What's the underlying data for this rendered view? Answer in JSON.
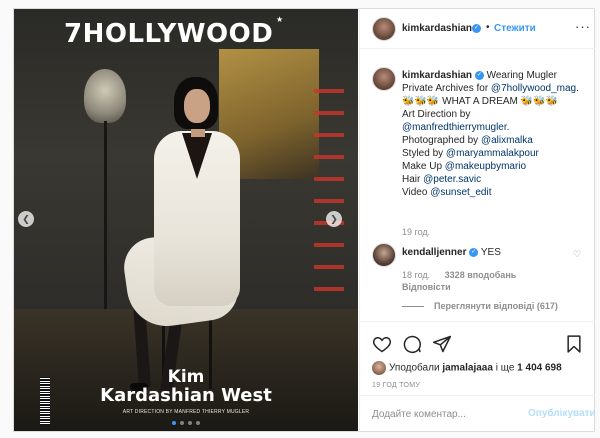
{
  "cover": {
    "magazine_title": "7HOLLYWOOD",
    "name_line1": "Kim",
    "name_line2": "Kardashian West",
    "credit": "ART DIRECTION BY MANFRED THIERRY MUGLER"
  },
  "carousel": {
    "total": 4,
    "active_index": 0,
    "prev_icon": "chevron-left-icon",
    "next_icon": "chevron-right-icon"
  },
  "header": {
    "username": "kimkardashian",
    "separator": "•",
    "follow_label": "Стежити",
    "more_label": "···"
  },
  "caption": {
    "username": "kimkardashian",
    "text_intro": " Wearing Mugler Private Archives for ",
    "mag_tag": "@7hollywood_mag",
    "emoji1": ". 🐝🐝🐝 WHAT A DREAM 🐝🐝🐝",
    "line_art": "Art Direction by",
    "tag_art": "@manfredthierrymugler.",
    "line_photo": "Photographed by ",
    "tag_photo": "@alixmalka",
    "line_style": "Styled by ",
    "tag_style": "@maryammalakpour",
    "line_makeup": "Make Up ",
    "tag_makeup": "@makeupbymario",
    "line_hair": "Hair ",
    "tag_hair": "@peter.savic",
    "line_video": "Video ",
    "tag_video": "@sunset_edit",
    "time": "19 год."
  },
  "comment": {
    "username": "kendalljenner",
    "text": "YES",
    "time": "18 год.",
    "likes": "3328 вподобань",
    "reply_label": "Відповісти",
    "view_replies": "Переглянути відповіді (617)"
  },
  "likes": {
    "prefix": "Уподобали ",
    "user": "jamalajaaa",
    "middle": " і ще ",
    "count": "1 404 698"
  },
  "post_time": "19 ГОД ТОМУ",
  "composer": {
    "placeholder": "Додайте коментар...",
    "publish_label": "Опублікувати"
  },
  "colors": {
    "accent": "#3897f0",
    "publish_disabled": "#b2dffc",
    "muted": "#8e8e8e",
    "tag": "#003569"
  }
}
